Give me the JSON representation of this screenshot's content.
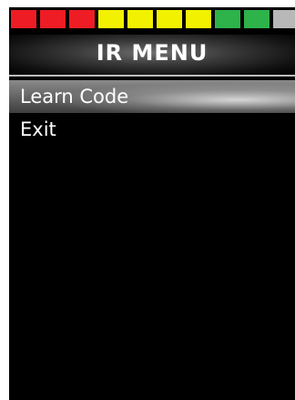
{
  "level_indicator": {
    "segments": [
      {
        "color": "#ee1c24"
      },
      {
        "color": "#ee1c24"
      },
      {
        "color": "#ee1c24"
      },
      {
        "color": "#f2f200"
      },
      {
        "color": "#f2f200"
      },
      {
        "color": "#f2f200"
      },
      {
        "color": "#f2f200"
      },
      {
        "color": "#2db34a"
      },
      {
        "color": "#2db34a"
      },
      {
        "color": "#b8b8b8"
      }
    ]
  },
  "menu": {
    "title": "IR MENU",
    "items": [
      {
        "label": "Learn Code",
        "selected": true
      },
      {
        "label": "Exit",
        "selected": false
      }
    ]
  }
}
